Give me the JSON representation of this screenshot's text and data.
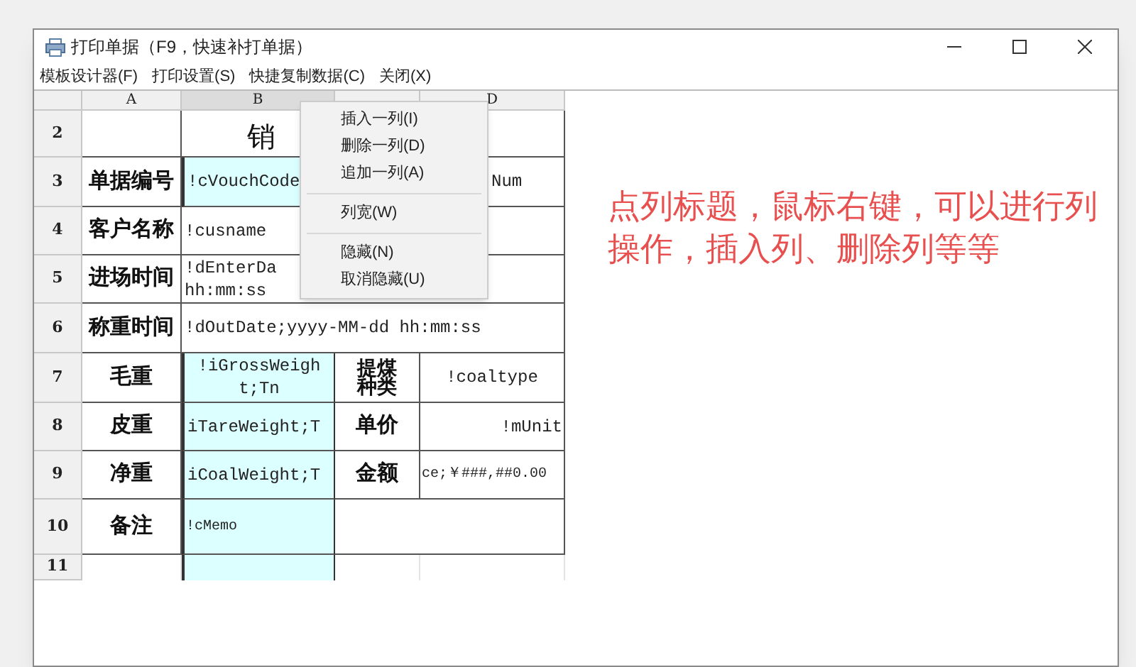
{
  "window": {
    "title": "打印单据（F9，快速补打单据）"
  },
  "menu_bar": [
    "模板设计器(F)",
    "打印设置(S)",
    "快捷复制数据(C)",
    "关闭(X)"
  ],
  "sheet": {
    "columns": [
      {
        "label": "A",
        "selected": false
      },
      {
        "label": "B",
        "selected": true
      },
      {
        "selected": false
      },
      {
        "label": "D",
        "selected": false
      }
    ],
    "rows": [
      {
        "number": "2",
        "cells": [
          {
            "kind": "empty"
          },
          {
            "kind": "title",
            "text": "销"
          }
        ]
      },
      {
        "number": "3",
        "cells": [
          {
            "kind": "label",
            "text": "单据编号"
          },
          {
            "kind": "field",
            "text": "!cVouchCode"
          },
          {
            "kind": "covered"
          },
          {
            "kind": "field_offset",
            "text": "Num"
          }
        ]
      },
      {
        "number": "4",
        "cells": [
          {
            "kind": "label",
            "text": "客户名称"
          },
          {
            "kind": "field_wide",
            "text": "!cusname"
          }
        ]
      },
      {
        "number": "5",
        "cells": [
          {
            "kind": "label",
            "text": "进场时间"
          },
          {
            "kind": "field_wide",
            "text": "!dEnterDa\nhh:mm:ss"
          }
        ]
      },
      {
        "number": "6",
        "cells": [
          {
            "kind": "label",
            "text": "称重时间"
          },
          {
            "kind": "field_wide",
            "text": "!dOutDate;yyyy-MM-dd hh:mm:ss"
          }
        ]
      },
      {
        "number": "7",
        "cells": [
          {
            "kind": "label",
            "text": "毛重"
          },
          {
            "kind": "field_center",
            "text": "!iGrossWeigh\nt;Tn"
          },
          {
            "kind": "label_tight",
            "text": "提煤种类"
          },
          {
            "kind": "field_center",
            "text": "!coaltype"
          }
        ]
      },
      {
        "number": "8",
        "cells": [
          {
            "kind": "label",
            "text": "皮重"
          },
          {
            "kind": "field",
            "text": "iTareWeight;T"
          },
          {
            "kind": "label",
            "text": "单价"
          },
          {
            "kind": "field_right",
            "text": "!mUnit"
          }
        ]
      },
      {
        "number": "9",
        "cells": [
          {
            "kind": "label",
            "text": "净重"
          },
          {
            "kind": "field",
            "text": "iCoalWeight;T"
          },
          {
            "kind": "label",
            "text": "金额"
          },
          {
            "kind": "field_small",
            "text": "ce;￥###,##0.00"
          }
        ]
      },
      {
        "number": "10",
        "cells": [
          {
            "kind": "label",
            "text": "备注"
          },
          {
            "kind": "field_small",
            "text": "!cMemo"
          },
          {
            "kind": "empty_pair"
          }
        ]
      },
      {
        "number": "11",
        "cells": [
          {
            "kind": "blank"
          },
          {
            "kind": "blank"
          },
          {
            "kind": "blank"
          },
          {
            "kind": "blank"
          }
        ]
      }
    ]
  },
  "context_menu": [
    {
      "kind": "item",
      "label": "插入一列(I)"
    },
    {
      "kind": "item",
      "label": "删除一列(D)"
    },
    {
      "kind": "item",
      "label": "追加一列(A)"
    },
    {
      "kind": "separator"
    },
    {
      "kind": "item",
      "label": "列宽(W)"
    },
    {
      "kind": "separator"
    },
    {
      "kind": "item",
      "label": "隐藏(N)"
    },
    {
      "kind": "item",
      "label": "取消隐藏(U)"
    }
  ],
  "annotation": "点列标题，鼠标右键，可以进行列操作，插入列、删除列等等"
}
